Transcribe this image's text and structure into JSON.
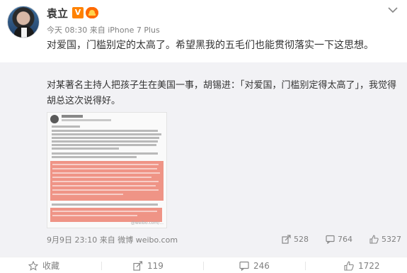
{
  "post": {
    "username": "袁立",
    "vip_badge": "V",
    "level_badge": "🐘",
    "time": "今天 08:30",
    "source_prefix": "来自",
    "source": "iPhone 7 Plus",
    "content": "对爱国，门槛别定的太高了。希望黑我的五毛们也能贯彻落实一下这思想。"
  },
  "repost": {
    "text": "对某著名主持人把孩子生在美国一事，胡锡进：「对爱国，门槛别定得太高了」，我觉得胡总这次说得好。",
    "time": "9月9日 23:10",
    "source_prefix": "来自",
    "source": "微博 weibo.com",
    "thumb_watermark": "@weibo.com/...",
    "share_count": "528",
    "comment_count": "764",
    "like_count": "5327"
  },
  "actions": {
    "favorite": "收藏",
    "share": "119",
    "comment": "246",
    "like": "1722"
  }
}
